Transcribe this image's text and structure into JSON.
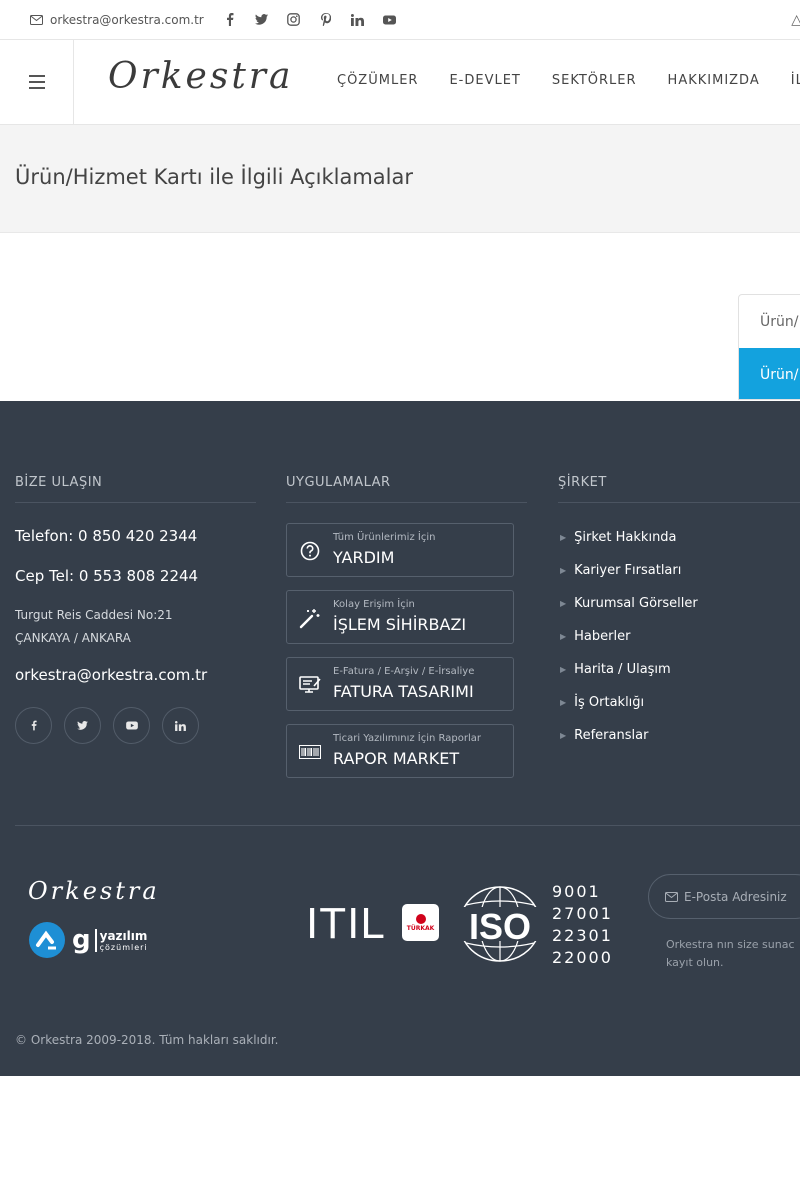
{
  "topbar": {
    "email": "orkestra@orkestra.com.tr",
    "socials": [
      "facebook-icon",
      "twitter-icon",
      "instagram-icon",
      "pinterest-icon",
      "linkedin-icon",
      "youtube-icon"
    ]
  },
  "header": {
    "logo": "Orkestra",
    "nav": [
      "ÇÖZÜMLER",
      "E-DEVLET",
      "SEKTÖRLER",
      "HAKKIMIZDA",
      "İL"
    ]
  },
  "page": {
    "title": "Ürün/Hizmet Kartı ile İlgili Açıklamalar",
    "tabs": [
      {
        "label": "Ürün/",
        "active": false
      },
      {
        "label": "Ürün/",
        "active": true
      }
    ]
  },
  "footer": {
    "contact": {
      "title": "BİZE ULAŞIN",
      "phone": "Telefon: 0 850 420 2344",
      "mobile": "Cep Tel: 0 553 808 2244",
      "address_line1": "Turgut Reis Caddesi No:21",
      "address_line2": "ÇANKAYA / ANKARA",
      "email": "orkestra@orkestra.com.tr"
    },
    "apps": {
      "title": "UYGULAMALAR",
      "items": [
        {
          "small": "Tüm Ürünlerimiz İçin",
          "big": "YARDIM",
          "icon": "help-icon"
        },
        {
          "small": "Kolay Erişim İçin",
          "big": "İŞLEM SİHİRBAZI",
          "icon": "magic-wand-icon"
        },
        {
          "small": "E-Fatura / E-Arşiv / E-İrsaliye",
          "big": "FATURA TASARIMI",
          "icon": "invoice-design-icon"
        },
        {
          "small": "Ticari Yazılımınız İçin Raporlar",
          "big": "RAPOR MARKET",
          "icon": "barcode-icon"
        }
      ]
    },
    "company": {
      "title": "ŞİRKET",
      "items": [
        "Şirket Hakkında",
        "Kariyer Fırsatları",
        "Kurumsal Görseller",
        "Haberler",
        "Harita / Ulaşım",
        "İş Ortaklığı",
        "Referanslar"
      ]
    },
    "logos": {
      "orkestra": "Orkestra",
      "gyazilim_letter": "g",
      "gyazilim_name": "yazılım",
      "gyazilim_sub": "çözümleri",
      "itil": "ITIL",
      "turk": "TÜRKAK",
      "iso": "ISO",
      "iso_numbers": [
        "9001",
        "27001",
        "22301",
        "22000"
      ]
    },
    "newsletter": {
      "placeholder": "E-Posta Adresiniz",
      "desc_line1": "Orkestra nın size sunac",
      "desc_line2": "kayıt olun."
    },
    "copyright": "© Orkestra 2009-2018. Tüm hakları saklıdır."
  }
}
